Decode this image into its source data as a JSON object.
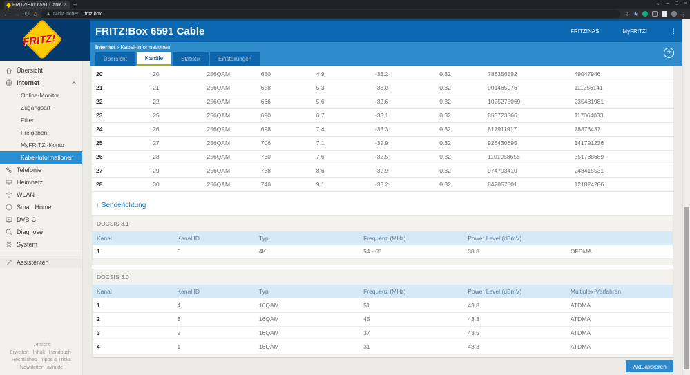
{
  "browser": {
    "tab_title": "FRITZ!Box 6591 Cable",
    "close_tab_glyph": "×",
    "new_tab_glyph": "+",
    "window_controls": {
      "chevron": "⌄",
      "minimize": "–",
      "maximize": "□",
      "close": "×"
    },
    "toolbar": {
      "back": "←",
      "forward": "→",
      "reload": "↻",
      "home": "⌂",
      "menu": "⋮",
      "share": "⇪",
      "star": "★"
    },
    "url_bar": {
      "warning_icon": "▲",
      "warning_text": "Nicht sicher",
      "url": "fritz.box"
    }
  },
  "header": {
    "product_title": "FRITZ!Box 6591 Cable",
    "nav_links": [
      {
        "label": "FRITZ!NAS"
      },
      {
        "label": "MyFRITZ!"
      }
    ],
    "menu_glyph": "⋮",
    "breadcrumb": {
      "section": "Internet",
      "separator": "›",
      "page": "Kabel-Informationen"
    },
    "help_glyph": "?"
  },
  "tabs": [
    {
      "label": "Übersicht",
      "active": false
    },
    {
      "label": "Kanäle",
      "active": true
    },
    {
      "label": "Statistik",
      "active": false
    },
    {
      "label": "Einstellungen",
      "active": false
    }
  ],
  "sidebar": {
    "items": [
      {
        "label": "Übersicht"
      },
      {
        "label": "Internet"
      },
      {
        "label": "Telefonie"
      },
      {
        "label": "Heimnetz"
      },
      {
        "label": "WLAN"
      },
      {
        "label": "Smart Home"
      },
      {
        "label": "DVB-C"
      },
      {
        "label": "Diagnose"
      },
      {
        "label": "System"
      },
      {
        "label": "Assistenten"
      }
    ],
    "internet_subitems": [
      {
        "label": "Online-Monitor",
        "active": false
      },
      {
        "label": "Zugangsart",
        "active": false
      },
      {
        "label": "Filter",
        "active": false
      },
      {
        "label": "Freigaben",
        "active": false
      },
      {
        "label": "MyFRITZ!-Konto",
        "active": false
      },
      {
        "label": "Kabel-Informationen",
        "active": true
      }
    ],
    "footer_rows": [
      [
        "Ansicht: Erweitert",
        "Inhalt",
        "Handbuch"
      ],
      [
        "Rechtliches",
        "Tipps & Tricks"
      ],
      [
        "Newsletter",
        "avm.de"
      ]
    ]
  },
  "main": {
    "downstream_table": {
      "rows": [
        [
          "20",
          "20",
          "256QAM",
          "650",
          "4.9",
          "-33.2",
          "0.32",
          "786356592",
          "49047946"
        ],
        [
          "21",
          "21",
          "256QAM",
          "658",
          "5.3",
          "-33.0",
          "0.32",
          "901465076",
          "111256141"
        ],
        [
          "22",
          "22",
          "256QAM",
          "666",
          "5.6",
          "-32.6",
          "0.32",
          "1025275069",
          "235481981"
        ],
        [
          "23",
          "25",
          "256QAM",
          "690",
          "6.7",
          "-33.1",
          "0.32",
          "853723566",
          "117064033"
        ],
        [
          "24",
          "26",
          "256QAM",
          "698",
          "7.4",
          "-33.3",
          "0.32",
          "817911917",
          "78873437"
        ],
        [
          "25",
          "27",
          "256QAM",
          "706",
          "7.1",
          "-32.9",
          "0.32",
          "926430695",
          "141791236"
        ],
        [
          "26",
          "28",
          "256QAM",
          "730",
          "7.6",
          "-32.5",
          "0.32",
          "1101958658",
          "351788689"
        ],
        [
          "27",
          "29",
          "256QAM",
          "738",
          "8.6",
          "-32.9",
          "0.32",
          "974793410",
          "248415531"
        ],
        [
          "28",
          "30",
          "256QAM",
          "746",
          "9.1",
          "-33.2",
          "0.32",
          "842057501",
          "121824286"
        ]
      ]
    },
    "upstream_heading": "↑ Senderichtung",
    "docsis31": {
      "section_title": "DOCSIS 3.1",
      "headers": [
        "Kanal",
        "Kanal ID",
        "Typ",
        "Frequenz (MHz)",
        "Power Level (dBmV)",
        ""
      ],
      "rows": [
        [
          "1",
          "0",
          "4K",
          "54 - 65",
          "38.8",
          "OFDMA"
        ]
      ]
    },
    "docsis30": {
      "section_title": "DOCSIS 3.0",
      "headers": [
        "Kanal",
        "Kanal ID",
        "Typ",
        "Frequenz (MHz)",
        "Power Level (dBmV)",
        "Multiplex-Verfahren"
      ],
      "rows": [
        [
          "1",
          "4",
          "16QAM",
          "51",
          "43.8",
          "ATDMA"
        ],
        [
          "2",
          "3",
          "16QAM",
          "45",
          "43.3",
          "ATDMA"
        ],
        [
          "3",
          "2",
          "16QAM",
          "37",
          "43.5",
          "ATDMA"
        ],
        [
          "4",
          "1",
          "16QAM",
          "31",
          "43.3",
          "ATDMA"
        ]
      ]
    },
    "refresh_button": "Aktualisieren"
  },
  "colors": {
    "header_blue": "#0c68b0",
    "band_blue": "#2f8ccb",
    "active_item_blue": "#2a8fd2",
    "tab_green_underline": "#9ab41b",
    "table_header_blue": "#d6e9f7",
    "logo_yellow": "#ffcc00",
    "logo_red": "#e30613"
  }
}
